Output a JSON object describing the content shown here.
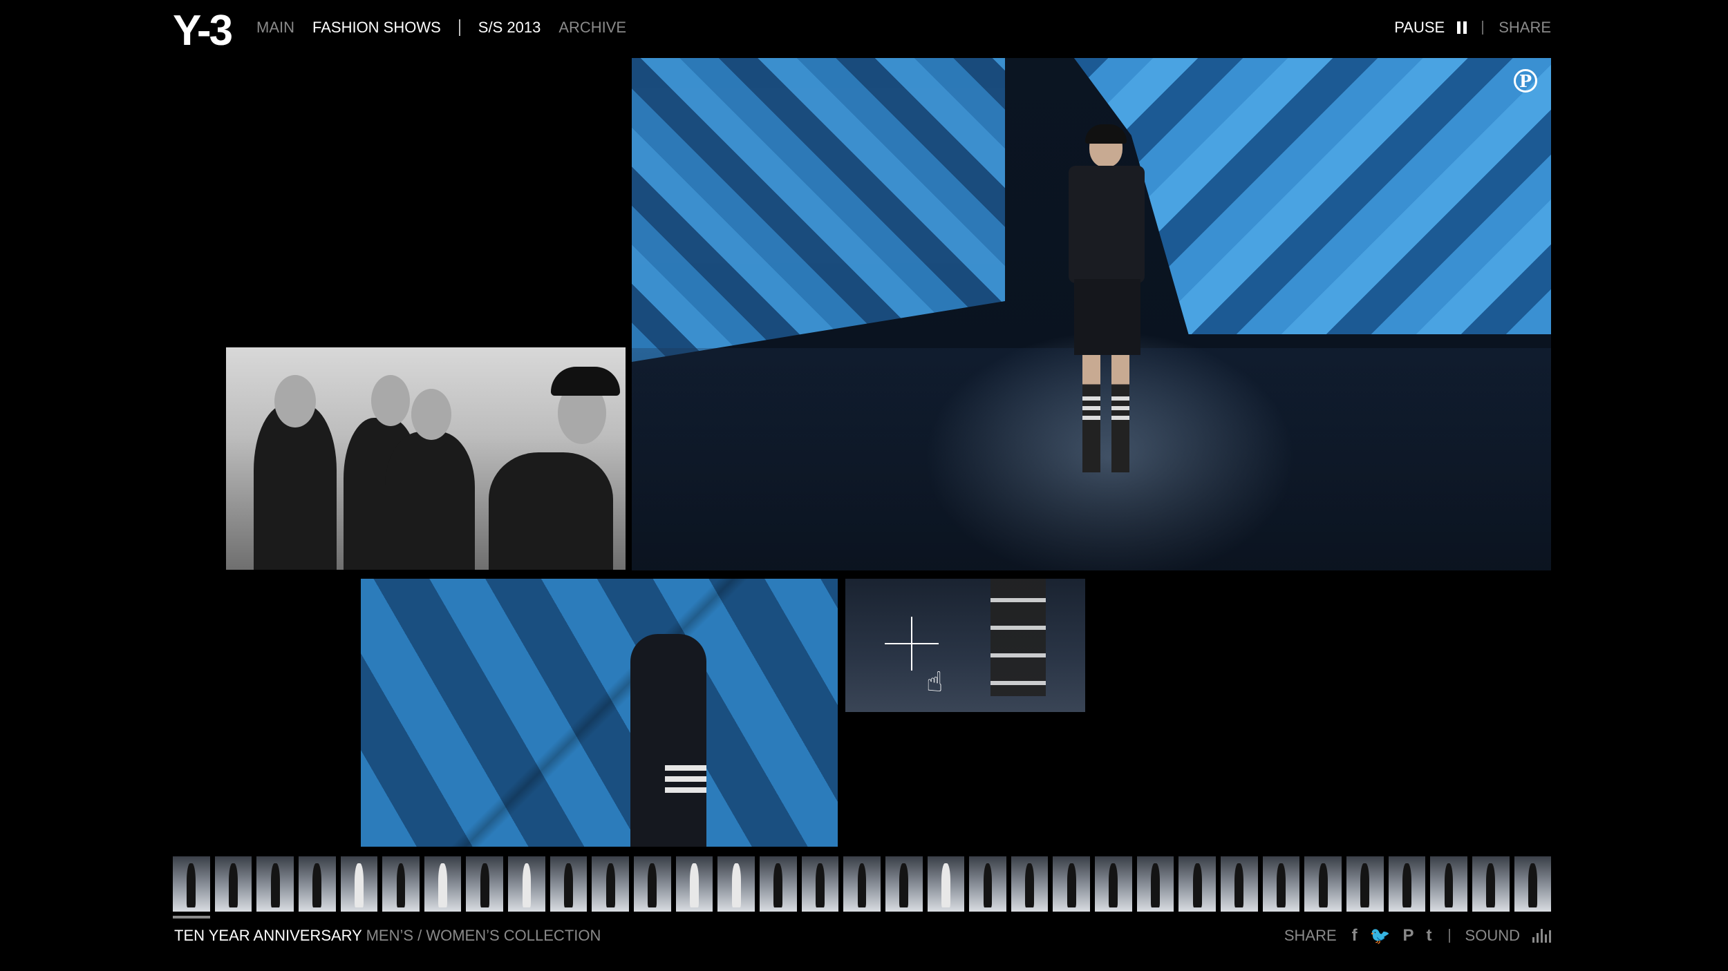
{
  "header": {
    "logo": "Y-3",
    "nav": {
      "main": "MAIN",
      "fashion_shows": "FASHION SHOWS",
      "season": "S/S 2013",
      "archive": "ARCHIVE"
    },
    "pause_label": "PAUSE",
    "share_label": "SHARE"
  },
  "footer": {
    "title": "TEN YEAR ANNIVERSARY",
    "subtitle": "MEN’S / WOMEN’S COLLECTION",
    "share_label": "SHARE",
    "social": [
      "f",
      "twitter",
      "pinterest",
      "t"
    ],
    "social_glyphs": [
      "f",
      "🐦",
      "P",
      "t"
    ],
    "sound_label": "SOUND"
  },
  "thumbnails_count": 33,
  "colors": {
    "accent_blue": "#2c7cbb",
    "dim_text": "#8a8a8a"
  }
}
